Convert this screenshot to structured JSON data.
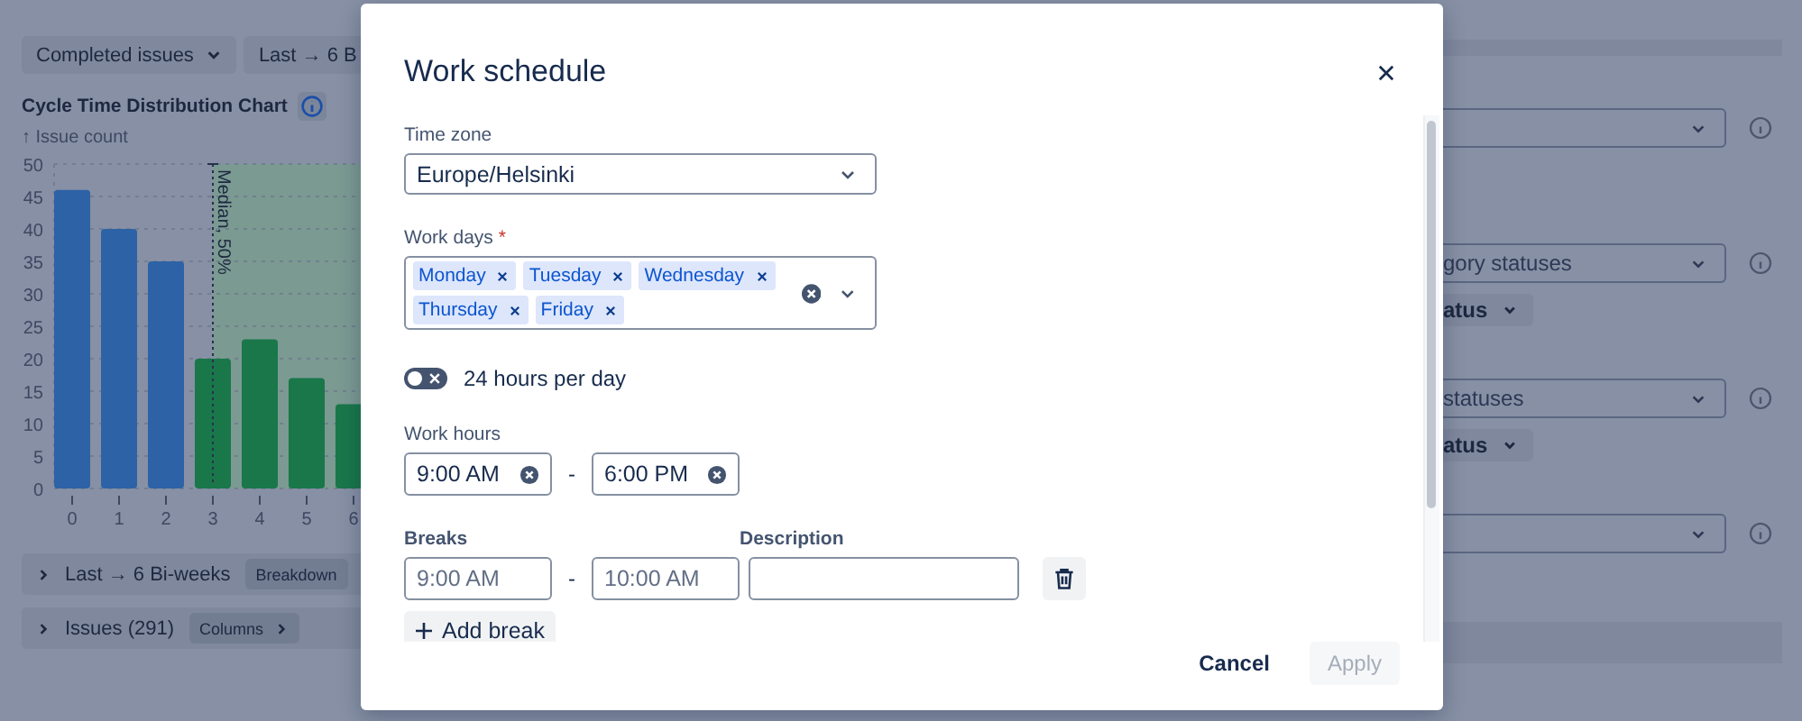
{
  "background": {
    "filters": [
      {
        "label": "Completed issues",
        "kind": "dropdown"
      },
      {
        "label": "Last → 6 B",
        "kind": "plain"
      }
    ],
    "chart": {
      "title": "Cycle Time Distribution Chart",
      "axis_caption": "↑ Issue count",
      "chart_data": {
        "type": "bar",
        "categories": [
          "0",
          "1",
          "2",
          "3",
          "4",
          "5",
          "6"
        ],
        "values": [
          46,
          40,
          35,
          20,
          23,
          17,
          13
        ],
        "ylim": [
          0,
          50
        ],
        "yticks": [
          0,
          5,
          10,
          15,
          20,
          25,
          30,
          35,
          40,
          45,
          50
        ],
        "grid": true,
        "ref_lines": [
          {
            "axis": "x",
            "value": "3",
            "label": "Median, 50%"
          }
        ]
      }
    },
    "sections": [
      {
        "title": "Last → 6 Bi-weeks",
        "button": "Breakdown",
        "chevron": false
      },
      {
        "title": "Issues (291)",
        "button": "Columns",
        "chevron": true
      }
    ],
    "settings": [
      {
        "kind": "select"
      },
      {
        "kind": "select",
        "value": "gory statuses",
        "button": "atus"
      },
      {
        "kind": "select",
        "value": "statuses",
        "button": "atus"
      },
      {
        "kind": "select"
      }
    ]
  },
  "modal": {
    "title": "Work schedule",
    "time_zone": {
      "label": "Time zone",
      "value": "Europe/Helsinki"
    },
    "work_days": {
      "label": "Work days",
      "required_mark": "*",
      "chips": [
        "Monday",
        "Tuesday",
        "Wednesday",
        "Thursday",
        "Friday"
      ]
    },
    "toggle": {
      "label": "24 hours per day",
      "on": false
    },
    "work_hours": {
      "label": "Work hours",
      "from": "9:00 AM",
      "separator": "-",
      "to": "6:00 PM"
    },
    "breaks": {
      "label": "Breaks",
      "description_label": "Description",
      "rows": [
        {
          "from_placeholder": "9:00 AM",
          "separator": "-",
          "to_placeholder": "10:00 AM"
        }
      ],
      "add": "Add break"
    },
    "buttons": [
      {
        "label": "Cancel",
        "kind": "subtle",
        "disabled": false
      },
      {
        "label": "Apply",
        "kind": "primary",
        "disabled": true
      }
    ]
  }
}
